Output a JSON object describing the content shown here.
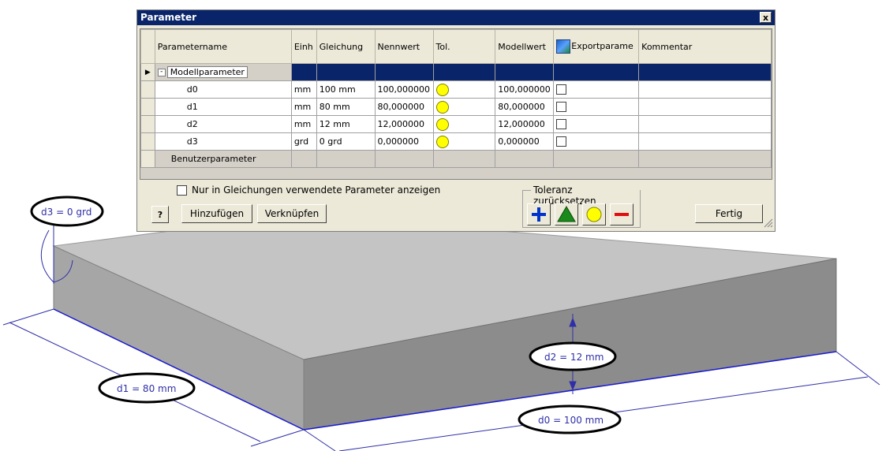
{
  "dialog": {
    "title": "Parameter",
    "close_label": "x",
    "columns": [
      "Parametername",
      "Einh",
      "Gleichung",
      "Nennwert",
      "Tol.",
      "Modellwert",
      "Exportparame",
      "Kommentar"
    ],
    "groups": {
      "model": "Modellparameter",
      "user": "Benutzerparameter"
    },
    "rows": [
      {
        "name": "d0",
        "unit": "mm",
        "equation": "100 mm",
        "nominal": "100,000000",
        "model": "100,000000"
      },
      {
        "name": "d1",
        "unit": "mm",
        "equation": "80 mm",
        "nominal": "80,000000",
        "model": "80,000000"
      },
      {
        "name": "d2",
        "unit": "mm",
        "equation": "12 mm",
        "nominal": "12,000000",
        "model": "12,000000"
      },
      {
        "name": "d3",
        "unit": "grd",
        "equation": "0 grd",
        "nominal": "0,000000",
        "model": "0,000000"
      }
    ],
    "checkbox_label": "Nur in Gleichungen verwendete Parameter anzeigen",
    "help_label": "?",
    "add_label": "Hinzufügen",
    "link_label": "Verknüpfen",
    "tolerance_group": "Toleranz zurücksetzen",
    "done_label": "Fertig"
  },
  "dimensions": {
    "d0": "d0 = 100 mm",
    "d1": "d1 = 80 mm",
    "d2": "d2 = 12 mm",
    "d3": "d3 = 0 grd"
  },
  "colors": {
    "title_bar": "#0a246a",
    "dialog_bg": "#ece9d8",
    "dimension": "#2f2fa8",
    "box_top": "#c4c4c4",
    "box_front": "#8c8c8c",
    "box_side": "#a6a6a6",
    "tol_plus": "#0033cc",
    "tol_up": "#1a8a1a",
    "tol_mid": "#ffff00",
    "tol_minus": "#e01010"
  },
  "icons": [
    "close-icon",
    "expand-row-icon",
    "collapse-icon",
    "export-parameter-icon",
    "help-icon",
    "plus-icon",
    "triangle-up-icon",
    "circle-icon",
    "minus-icon",
    "resize-grip-icon"
  ]
}
